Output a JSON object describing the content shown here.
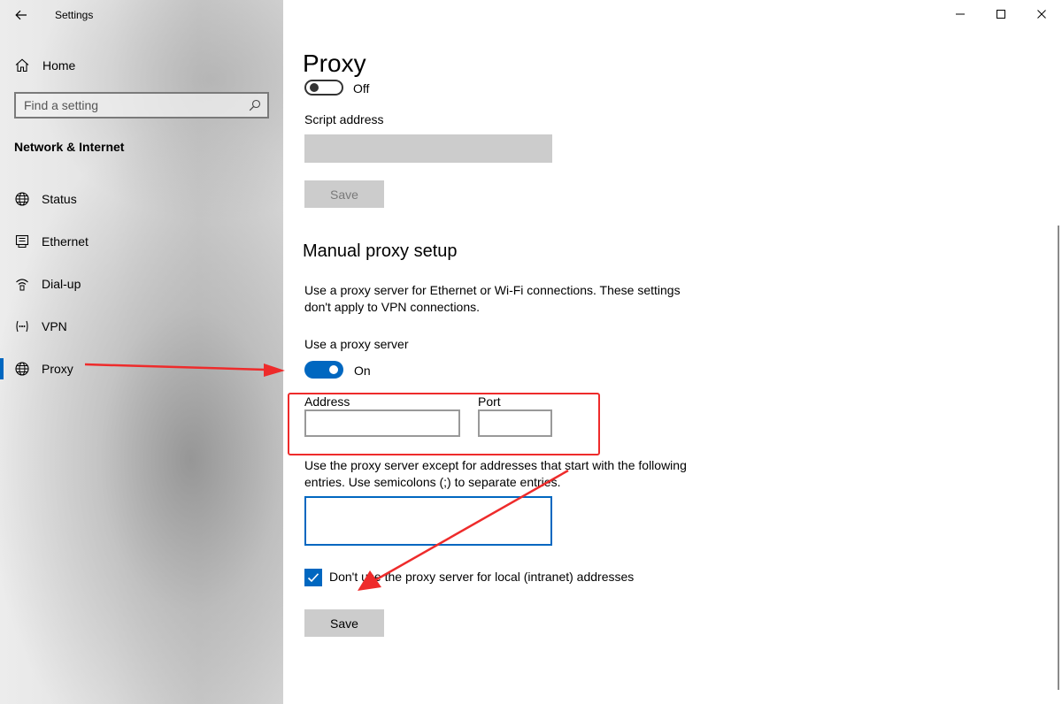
{
  "window": {
    "app_title": "Settings"
  },
  "sidebar": {
    "home_label": "Home",
    "search_placeholder": "Find a setting",
    "section_title": "Network & Internet",
    "items": [
      {
        "label": "Status",
        "icon": "globe-icon"
      },
      {
        "label": "Ethernet",
        "icon": "ethernet-icon"
      },
      {
        "label": "Dial-up",
        "icon": "dialup-icon"
      },
      {
        "label": "VPN",
        "icon": "vpn-icon"
      },
      {
        "label": "Proxy",
        "icon": "globe-icon",
        "active": true
      }
    ]
  },
  "main": {
    "page_title": "Proxy",
    "auto_setup": {
      "toggle_state": "Off",
      "script_address_label": "Script address",
      "script_address_value": "",
      "save_label": "Save"
    },
    "manual_setup": {
      "heading": "Manual proxy setup",
      "description": "Use a proxy server for Ethernet or Wi-Fi connections. These settings don't apply to VPN connections.",
      "use_proxy_label": "Use a proxy server",
      "toggle_state": "On",
      "address_label": "Address",
      "address_value": "",
      "port_label": "Port",
      "port_value": "",
      "exceptions_text": "Use the proxy server except for addresses that start with the following entries. Use semicolons (;) to separate entries.",
      "exceptions_value": "",
      "local_checkbox_label": "Don't use the proxy server for local (intranet) addresses",
      "local_checkbox_checked": true,
      "save_label": "Save"
    }
  },
  "colors": {
    "accent": "#0067c0",
    "annotation": "#ee2b2b"
  }
}
